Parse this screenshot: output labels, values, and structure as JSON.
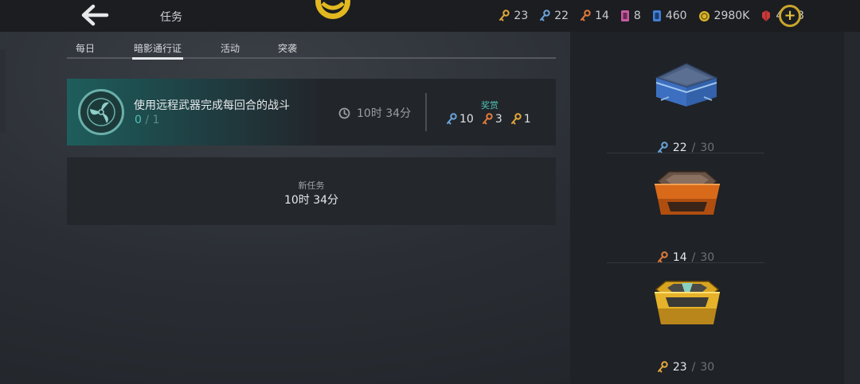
{
  "header": {
    "title": "任务"
  },
  "currencies": [
    {
      "icon": "gold-key-icon",
      "value": "23",
      "color": "#e0a63a"
    },
    {
      "icon": "blue-key-icon",
      "value": "22",
      "color": "#6aa3d8"
    },
    {
      "icon": "orange-key-icon",
      "value": "14",
      "color": "#e07a3a"
    },
    {
      "icon": "pink-ticket-icon",
      "value": "8",
      "color": "#c85aa0"
    },
    {
      "icon": "blue-card-icon",
      "value": "460",
      "color": "#3f7fd6"
    },
    {
      "icon": "gold-coin-icon",
      "value": "2980K",
      "color": "#d9b42a"
    },
    {
      "icon": "red-gem-icon",
      "value": "4353",
      "color": "#c83a3a"
    }
  ],
  "tabs": [
    {
      "label": "每日",
      "active": false
    },
    {
      "label": "暗影通行证",
      "active": true
    },
    {
      "label": "活动",
      "active": false
    },
    {
      "label": "突袭",
      "active": false
    }
  ],
  "task": {
    "description": "使用远程武器完成每回合的战斗",
    "progress_current": "0",
    "progress_sep": "/",
    "progress_max": "1",
    "timer": "10时 34分",
    "reward_label": "奖赏",
    "rewards": [
      {
        "icon": "blue-key-icon",
        "value": "10"
      },
      {
        "icon": "orange-key-icon",
        "value": "3"
      },
      {
        "icon": "gold-key-icon",
        "value": "1"
      }
    ]
  },
  "new_task": {
    "label": "新任务",
    "timer": "10时 34分"
  },
  "chests": [
    {
      "name": "blue-chest",
      "have": "22",
      "sep": "/",
      "total": "30",
      "key_icon": "blue-key-icon"
    },
    {
      "name": "orange-chest",
      "have": "14",
      "sep": "/",
      "total": "30",
      "key_icon": "orange-key-icon"
    },
    {
      "name": "gold-chest",
      "have": "23",
      "sep": "/",
      "total": "30",
      "key_icon": "gold-key-icon"
    }
  ],
  "colors": {
    "accent_teal": "#4fc1b4",
    "gold": "#e8c23a"
  }
}
